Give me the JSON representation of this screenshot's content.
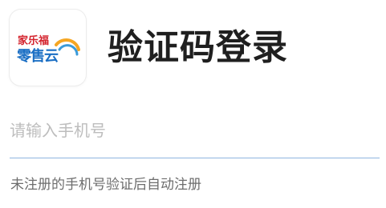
{
  "logo": {
    "line1": "家乐福",
    "line2": "零售云",
    "colors": {
      "red": "#d4232d",
      "blue": "#1b6fc4",
      "arc_orange": "#f5a623",
      "arc_blue": "#3a9ad9"
    }
  },
  "header": {
    "title": "验证码登录"
  },
  "phone_input": {
    "value": "",
    "placeholder": "请输入手机号",
    "underline_color": "#8fb4df"
  },
  "hint": {
    "text": "未注册的手机号验证后自动注册"
  }
}
